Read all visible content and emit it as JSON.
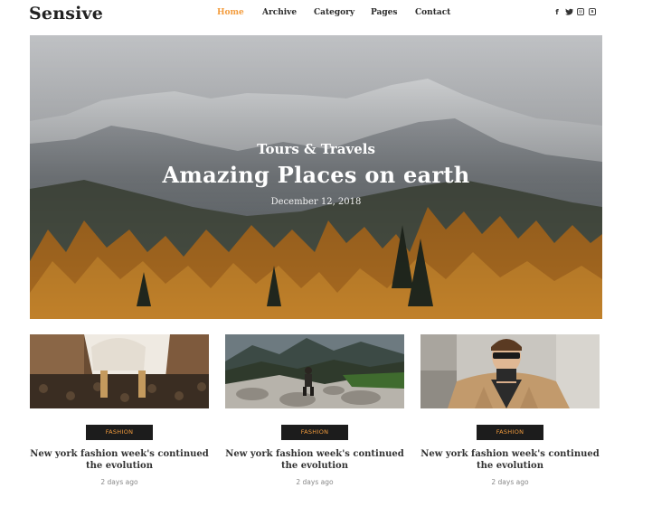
{
  "brand": {
    "logo": "Sensive"
  },
  "nav": {
    "items": [
      {
        "label": "Home",
        "active": true
      },
      {
        "label": "Archive",
        "active": false
      },
      {
        "label": "Category",
        "active": false
      },
      {
        "label": "Pages",
        "active": false
      },
      {
        "label": "Contact",
        "active": false
      }
    ],
    "active_color": "#f39c3d"
  },
  "social": {
    "icons": [
      {
        "name": "facebook-icon",
        "glyph": "f"
      },
      {
        "name": "twitter-icon",
        "glyph": "t"
      },
      {
        "name": "instagram-icon",
        "glyph": "◎"
      },
      {
        "name": "skype-icon",
        "glyph": "s"
      }
    ]
  },
  "hero": {
    "subtitle": "Tours & Travels",
    "title": "Amazing Places on earth",
    "date": "December 12, 2018"
  },
  "posts": [
    {
      "category": "FASHION",
      "title": "New york fashion week's continued the evolution",
      "meta": "2 days ago",
      "image": "handbag-photo"
    },
    {
      "category": "FASHION",
      "title": "New york fashion week's continued the evolution",
      "meta": "2 days ago",
      "image": "mountain-hiker-photo"
    },
    {
      "category": "FASHION",
      "title": "New york fashion week's continued the evolution",
      "meta": "2 days ago",
      "image": "man-sunglasses-photo"
    }
  ],
  "colors": {
    "accent": "#f39c3d",
    "badge_bg": "#1c1c1c"
  }
}
